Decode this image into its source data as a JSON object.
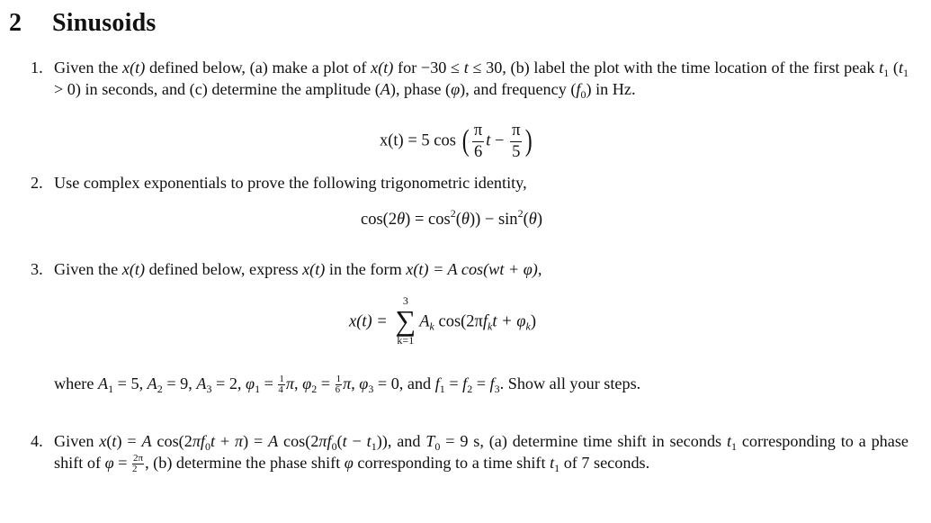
{
  "section": {
    "number": "2",
    "title": "Sinusoids"
  },
  "problems": [
    {
      "label": "1.",
      "text_parts": {
        "p1": "Given the ",
        "xt": "x(t)",
        "p2": " defined below, (a) make a plot of ",
        "p3": " for −30 ≤ ",
        "t": "t",
        "p4": " ≤ 30, (b) label the plot with the time location of the first peak ",
        "t1": "t",
        "sub1": "1",
        "p5": " (",
        "p6": " > 0) in seconds, and (c) determine the amplitude (",
        "A": "A",
        "p7": "), phase (",
        "phi": "φ",
        "p8": "), and frequency (",
        "f": "f",
        "sub0": "0",
        "p9": ") in Hz."
      },
      "equation": {
        "lhs": "x(t) = 5 cos",
        "frac1_num": "π",
        "frac1_den": "6",
        "var": "t",
        "minus": "−",
        "frac2_num": "π",
        "frac2_den": "5",
        "text": "x(t) = 5 cos(π/6 t − π/5)"
      }
    },
    {
      "label": "2.",
      "text": "Use complex exponentials to prove the following trigonometric identity,",
      "equation": {
        "text": "cos(2θ) = cos²(θ) − sin²(θ)",
        "p1": "cos(2",
        "theta": "θ",
        "p2": ") = cos",
        "sq": "2",
        "p3": "(",
        "p4": ") − sin",
        "p5": "("
      }
    },
    {
      "label": "3.",
      "text_parts": {
        "p1": "Given the ",
        "xt": "x(t)",
        "p2": " defined below, express ",
        "p3": " in the form ",
        "form": "x(t) = A cos(wt + φ),"
      },
      "equation": {
        "lhs": "x(t) =",
        "sum_upper": "3",
        "sum_lower": "k=1",
        "sigma": "∑",
        "term": "A",
        "k": "k",
        "cos": " cos(2π",
        "f": "f",
        "t_plus": "t + ",
        "phi": "φ",
        "close": ")",
        "text": "x(t) = Σ_{k=1}^{3} A_k cos(2π f_k t + φ_k)"
      },
      "where": {
        "text": "where A1 = 5, A2 = 9, A3 = 2, φ1 = 1/4 π, φ2 = 1/6 π, φ3 = 0, and f1 = f2 = f3. Show all your steps.",
        "A1": "5",
        "A2": "9",
        "A3": "2",
        "phi1_num": "1",
        "phi1_den": "4",
        "phi2_num": "1",
        "phi2_den": "6",
        "phi3": "0",
        "trailing": "Show all your steps."
      }
    },
    {
      "label": "4.",
      "text": "Given x(t) = A cos(2πf0t + π) = A cos(2πf0(t − t1)), and T0 = 9 s, (a) determine time shift in seconds t1 corresponding to a phase shift of φ = 2π/2, (b) determine the phase shift φ corresponding to a time shift t1 of 7 seconds.",
      "T0": "9 s",
      "phase_num": "2π",
      "phase_den": "2",
      "shift_seconds": "7 seconds."
    }
  ]
}
